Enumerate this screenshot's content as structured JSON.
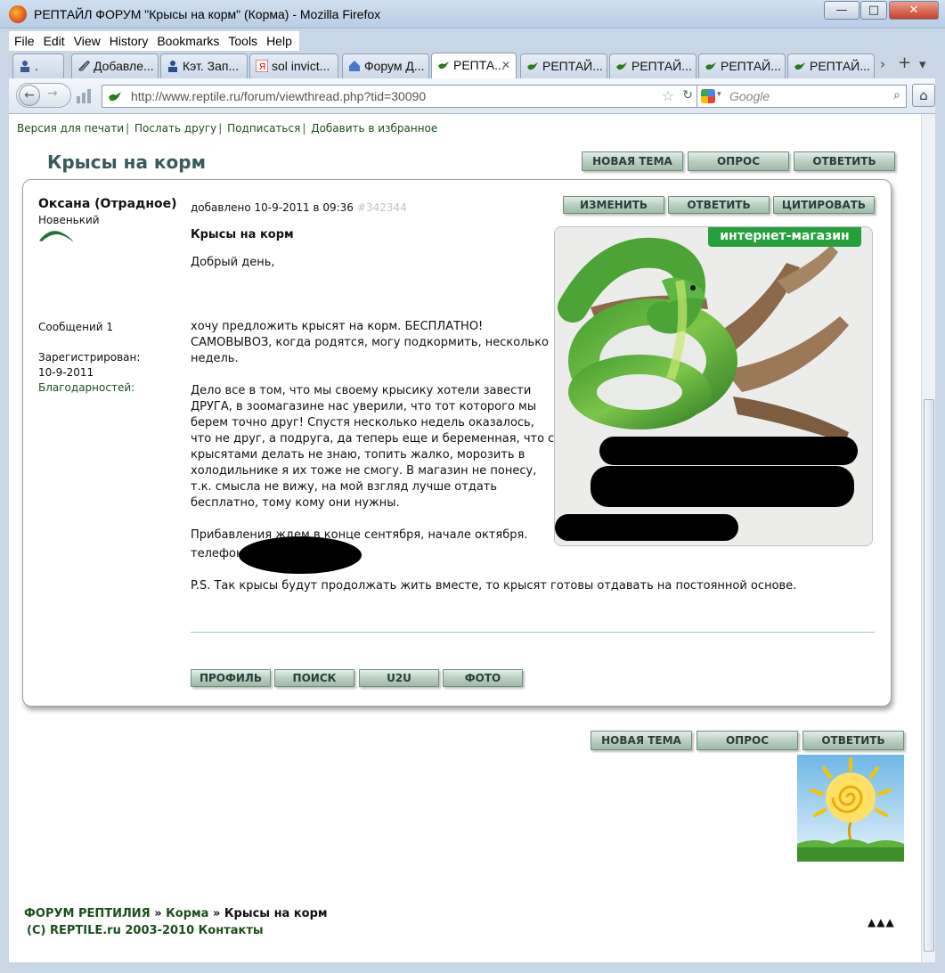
{
  "window": {
    "title": "РЕПТАЙЛ ФОРУМ \"Крысы на корм\" (Корма) - Mozilla Firefox",
    "minimize_label": "—",
    "maximize_label": "□",
    "close_label": "✕"
  },
  "menu": [
    "File",
    "Edit",
    "View",
    "History",
    "Bookmarks",
    "Tools",
    "Help"
  ],
  "tabs": [
    {
      "label": ".",
      "icon": "person-icon",
      "active": false
    },
    {
      "label": "Добавле...",
      "icon": "paperclip-icon",
      "active": false
    },
    {
      "label": "Кэт. Зап...",
      "icon": "person-icon",
      "active": false
    },
    {
      "label": "sol invict...",
      "icon": "yandex-icon",
      "active": false
    },
    {
      "label": "Форум Д...",
      "icon": "house-icon",
      "active": false
    },
    {
      "label": "РЕПТА...",
      "icon": "lizard-icon",
      "active": true
    },
    {
      "label": "РЕПТАЙ...",
      "icon": "lizard-icon",
      "active": false
    },
    {
      "label": "РЕПТАЙ...",
      "icon": "lizard-icon",
      "active": false
    },
    {
      "label": "РЕПТАЙ...",
      "icon": "lizard-icon",
      "active": false
    },
    {
      "label": "РЕПТАЙ...",
      "icon": "lizard-icon",
      "active": false
    }
  ],
  "nav": {
    "url": "http://www.reptile.ru/forum/viewthread.php?tid=30090",
    "search_placeholder": "Google"
  },
  "toplinks": [
    "Версия для печати",
    "Послать другу",
    "Подписаться",
    "Добавить в избранное"
  ],
  "thread": {
    "title": "Крысы на корм",
    "buttons": [
      "НОВАЯ ТЕМА",
      "ОПРОС",
      "ОТВЕТИТЬ"
    ]
  },
  "post": {
    "author": "Оксана (Отрадное)",
    "rank": "Новенький",
    "messages": "Сообщений 1",
    "registered_label": "Зарегистрирован:",
    "registered_date": "10-9-2011",
    "thanks": "Благодарностей:",
    "date": "добавлено 10-9-2011 в 09:36",
    "post_id": "#342344",
    "action_buttons": [
      "ИЗМЕНИТЬ",
      "ОТВЕТИТЬ",
      "ЦИТИРОВАТЬ"
    ],
    "subject": "Крысы на корм",
    "paragraphs": [
      "Добрый день,",
      "",
      "хочу предложить крысят на корм. БЕСПЛАТНО! САМОВЫВОЗ, когда родятся, могу подкормить, несколько недель.",
      "Дело все в том, что мы своему крысику хотели завести ДРУГА, в зоомагазине нас уверили, что тот которого мы берем точно друг! Спустя несколько недель оказалось, что не друг, а подруга, да теперь еще и беременная, что с крысятами делать не знаю, топить жалко, морозить в холодильнике я их тоже не смогу. В магазин не понесу, т.к. смысла не вижу, на мой взгляд лучше отдать бесплатно, тому кому они нужны.",
      "Прибавления ждем в конце сентября, начале октября."
    ],
    "phone_label": "телефон",
    "ps": "P.S. Так крысы будут продолжать жить вместе, то крысят готовы отдавать на постоянной основе.",
    "ad_badge": "интернет-магазин",
    "bottom_buttons": [
      "ПРОФИЛЬ",
      "ПОИСК",
      "U2U",
      "ФОТО"
    ]
  },
  "bottom_buttons": [
    "НОВАЯ ТЕМА",
    "ОПРОС",
    "ОТВЕТИТЬ"
  ],
  "footer": {
    "crumb1": "ФОРУМ РЕПТИЛИЯ",
    "crumb_sep": "»",
    "crumb2": "Корма",
    "crumb3": "Крысы на корм",
    "copyright": "(C) REPTILE.ru 2003-2010",
    "contacts": "Контакты",
    "arrows": "▲▲▲"
  },
  "colors": {
    "forum_green": "#1d4e1d",
    "button_face": "#b9cfc2",
    "ad_green": "#25a03b"
  }
}
